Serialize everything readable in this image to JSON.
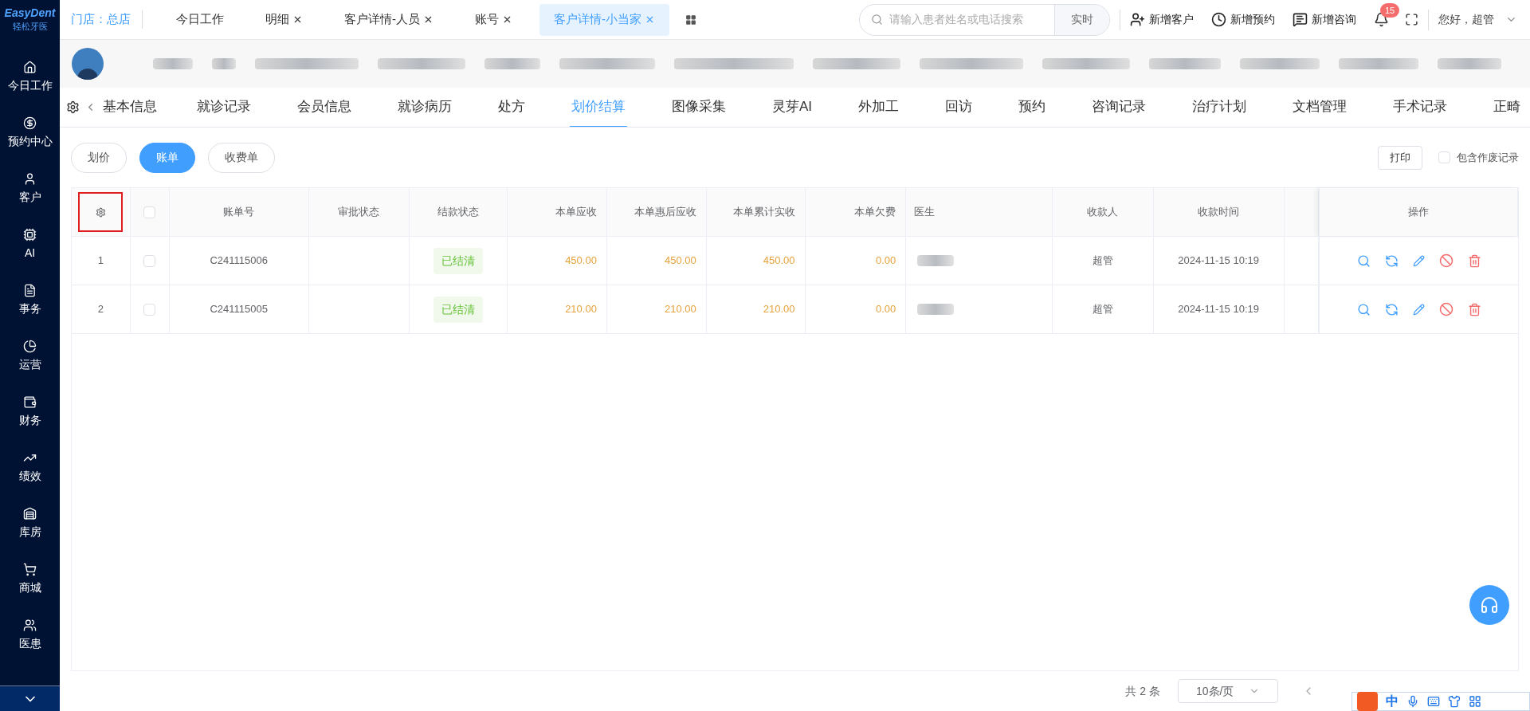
{
  "sidebar": {
    "logo": "EasyDent",
    "logo_subtitle": "轻松牙医",
    "items": [
      {
        "label": "今日工作"
      },
      {
        "label": "预约中心"
      },
      {
        "label": "客户"
      },
      {
        "label": "AI"
      },
      {
        "label": "事务"
      },
      {
        "label": "运营"
      },
      {
        "label": "财务"
      },
      {
        "label": "绩效"
      },
      {
        "label": "库房"
      },
      {
        "label": "商城"
      },
      {
        "label": "医患"
      }
    ]
  },
  "top_bar": {
    "store": "门店：总店",
    "tabs": [
      {
        "label": "今日工作",
        "closable": false,
        "selected": false
      },
      {
        "label": "明细",
        "closable": true,
        "selected": false
      },
      {
        "label": "客户详情-人员",
        "closable": true,
        "selected": false
      },
      {
        "label": "账号",
        "closable": true,
        "selected": false
      },
      {
        "label": "客户详情-小当家",
        "closable": true,
        "selected": true
      }
    ],
    "search": {
      "placeholder": "请输入患者姓名或电话搜索",
      "button": "实时"
    },
    "actions": [
      {
        "label": "新增客户"
      },
      {
        "label": "新增预约"
      },
      {
        "label": "新增咨询"
      }
    ],
    "notification_count": "15",
    "greeting": "您好，超管"
  },
  "detail_tabs": [
    {
      "label": "基本信息",
      "selected": false
    },
    {
      "label": "就诊记录",
      "selected": false
    },
    {
      "label": "会员信息",
      "selected": false
    },
    {
      "label": "就诊病历",
      "selected": false
    },
    {
      "label": "处方",
      "selected": false
    },
    {
      "label": "划价结算",
      "selected": true
    },
    {
      "label": "图像采集",
      "selected": false
    },
    {
      "label": "灵芽AI",
      "selected": false
    },
    {
      "label": "外加工",
      "selected": false
    },
    {
      "label": "回访",
      "selected": false
    },
    {
      "label": "预约",
      "selected": false
    },
    {
      "label": "咨询记录",
      "selected": false
    },
    {
      "label": "治疗计划",
      "selected": false
    },
    {
      "label": "文档管理",
      "selected": false
    },
    {
      "label": "手术记录",
      "selected": false
    },
    {
      "label": "正畸",
      "selected": false
    }
  ],
  "sub_tabs": [
    {
      "label": "划价",
      "selected": false
    },
    {
      "label": "账单",
      "selected": true
    },
    {
      "label": "收费单",
      "selected": false
    }
  ],
  "print_button": "打印",
  "include_void": {
    "label": "包含作废记录",
    "checked": false
  },
  "table": {
    "select_all_checked": false,
    "columns": [
      "账单号",
      "审批状态",
      "结款状态",
      "本单应收",
      "本单惠后应收",
      "本单累计实收",
      "本单欠费",
      "医生",
      "收款人",
      "收款时间",
      "操作"
    ],
    "rows": [
      {
        "index": "1",
        "checked": false,
        "bill_no": "C241115006",
        "status": "已结清",
        "receivable": "450.00",
        "discounted": "450.00",
        "received": "450.00",
        "arrears": "0.00",
        "payee": "超管",
        "time": "2024-11-15 10:19"
      },
      {
        "index": "2",
        "checked": false,
        "bill_no": "C241115005",
        "status": "已结清",
        "receivable": "210.00",
        "discounted": "210.00",
        "received": "210.00",
        "arrears": "0.00",
        "payee": "超管",
        "time": "2024-11-15 10:19"
      }
    ]
  },
  "pagination": {
    "total": "共 2 条",
    "page_size": "10条/页"
  },
  "ime_toolbar": {
    "mode": "中"
  }
}
